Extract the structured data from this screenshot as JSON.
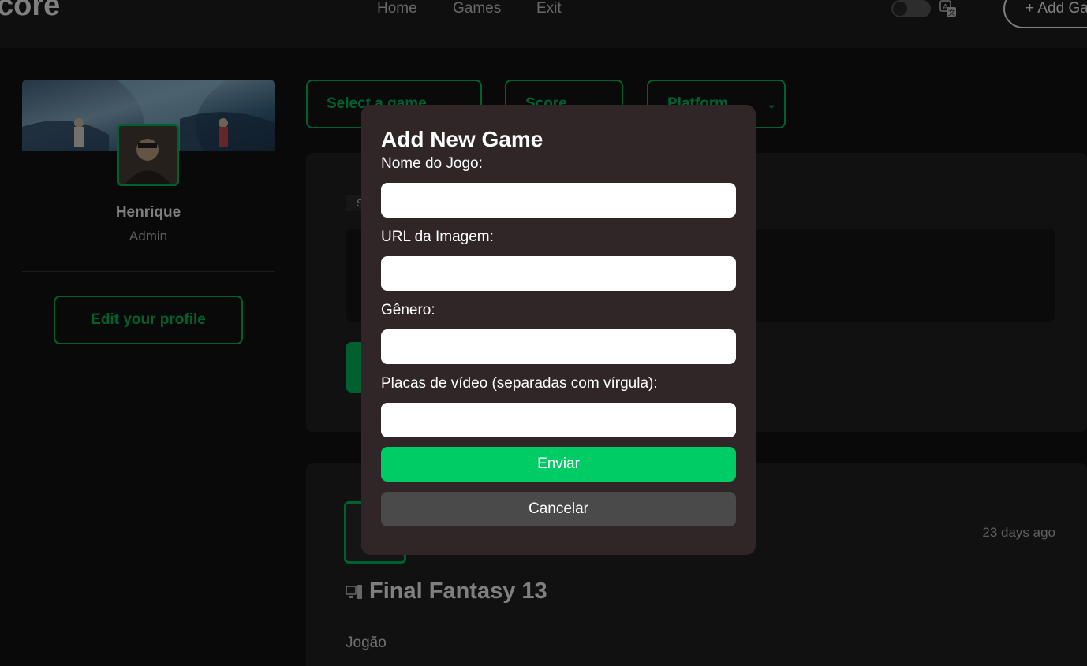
{
  "header": {
    "brand": "core",
    "nav": [
      {
        "label": "Home"
      },
      {
        "label": "Games"
      },
      {
        "label": "Exit"
      }
    ],
    "add_game_label": "+ Add Ga",
    "theme_toggle_icon": "toggle-icon",
    "translate_icon": "translate-icon"
  },
  "sidebar": {
    "name": "Henrique",
    "role": "Admin",
    "edit_profile_label": "Edit your profile"
  },
  "filters": {
    "game": "Select a game",
    "score": "Score",
    "platform": "Platform"
  },
  "composer": {
    "tag": "S"
  },
  "post": {
    "time": "23 days ago",
    "title": "Final Fantasy 13",
    "platform_icon": "pc-icon",
    "body": "Jogão"
  },
  "modal": {
    "title": "Add New Game",
    "fields": [
      {
        "label": "Nome do Jogo:",
        "value": ""
      },
      {
        "label": "URL da Imagem:",
        "value": ""
      },
      {
        "label": "Gênero:",
        "value": ""
      },
      {
        "label": "Placas de vídeo (separadas com vírgula):",
        "value": ""
      }
    ],
    "submit_label": "Enviar",
    "cancel_label": "Cancelar"
  },
  "colors": {
    "accent": "#00cc66",
    "modal_bg": "#302628",
    "page_bg": "#121212"
  }
}
